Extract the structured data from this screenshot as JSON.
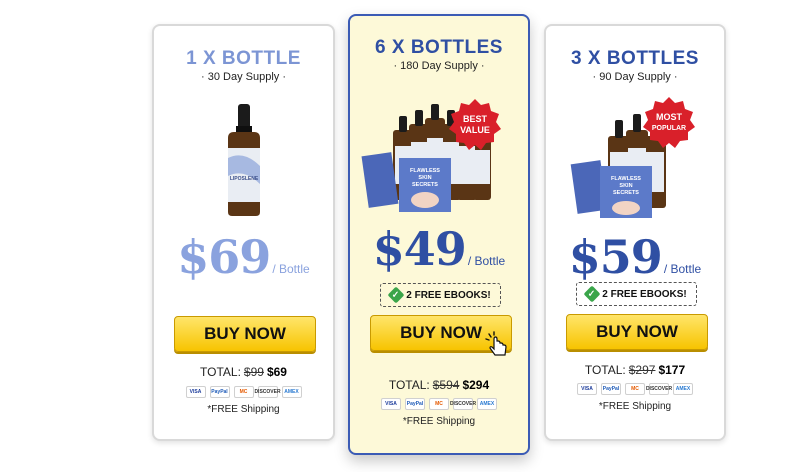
{
  "colors": {
    "card1_accent": "#7c95d4",
    "card2_accent": "#2f4fa3",
    "card3_accent": "#2f4fa3",
    "featured_bg": "#fdf9d8",
    "button_yellow": "#f7c400",
    "badge_red": "#d9202a"
  },
  "packages": [
    {
      "title": "1 X BOTTLE",
      "supply": "· 30 Day Supply ·",
      "price": "$69",
      "per": "/ Bottle",
      "button": "BUY NOW",
      "total_label": "TOTAL:",
      "old_total": "$99",
      "new_total": "$69",
      "shipping": "*FREE Shipping",
      "bottles": 1
    },
    {
      "title": "6 X BOTTLES",
      "supply": "· 180 Day Supply ·",
      "badge": [
        "BEST",
        "VALUE"
      ],
      "ebooks": "2 FREE EBOOKS!",
      "price": "$49",
      "per": "/ Bottle",
      "button": "BUY NOW",
      "total_label": "TOTAL:",
      "old_total": "$594",
      "new_total": "$294",
      "shipping": "*FREE Shipping",
      "bottles": 6
    },
    {
      "title": "3 X BOTTLES",
      "supply": "· 90 Day Supply ·",
      "badge": [
        "MOST",
        "POPULAR"
      ],
      "ebooks": "2 FREE EBOOKS!",
      "price": "$59",
      "per": "/ Bottle",
      "button": "BUY NOW",
      "total_label": "TOTAL:",
      "old_total": "$297",
      "new_total": "$177",
      "shipping": "*FREE Shipping",
      "bottles": 3
    }
  ],
  "product_label": "LIPOSLENE",
  "ebook_cover": [
    "FLAWLESS",
    "SKIN",
    "SECRETS"
  ],
  "payment_icons": [
    "visa-icon",
    "paypal-icon",
    "mastercard-icon",
    "discover-icon",
    "amex-icon"
  ],
  "payment_text": [
    "VISA",
    "PayPal",
    "MC",
    "DISCOVER",
    "AMEX"
  ]
}
